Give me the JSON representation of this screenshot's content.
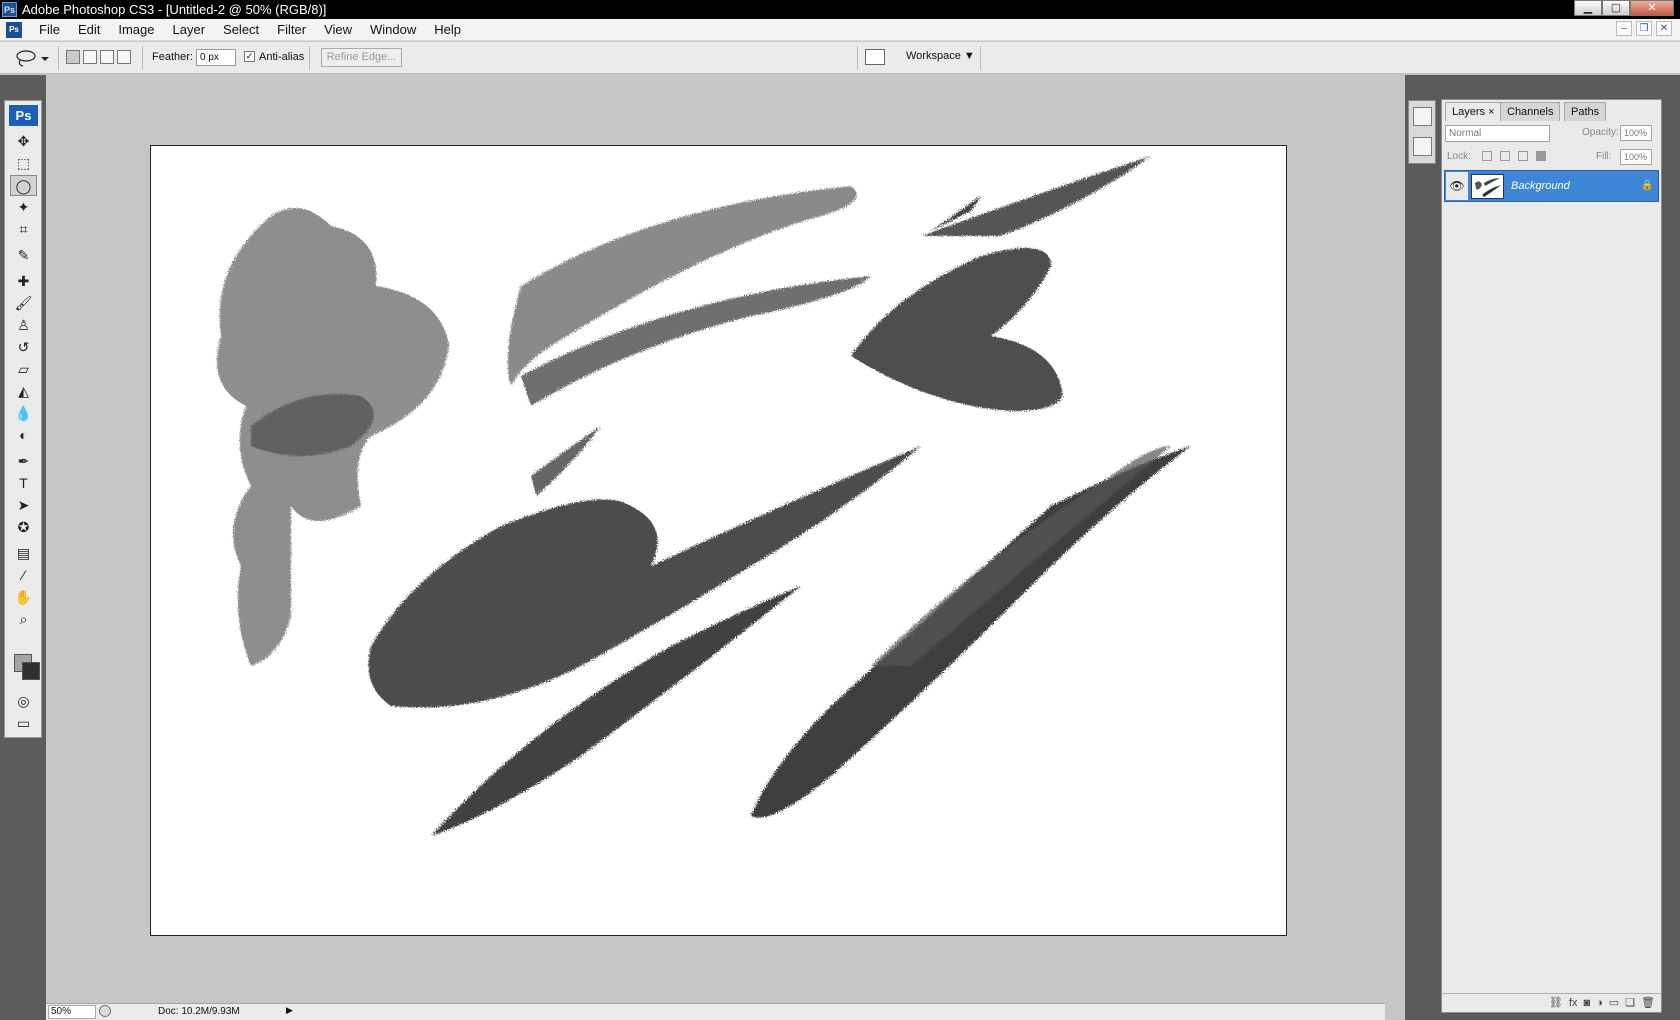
{
  "window": {
    "title": "Adobe Photoshop CS3 - [Untitled-2 @ 50% (RGB/8)]",
    "app_icon": "Ps",
    "controls": {
      "minimize": "▁",
      "maximize": "▢",
      "close": "✕"
    }
  },
  "menubar": {
    "items": [
      "File",
      "Edit",
      "Image",
      "Layer",
      "Select",
      "Filter",
      "View",
      "Window",
      "Help"
    ],
    "doc_controls": {
      "minimize": "–",
      "restore": "❐",
      "close": "✕"
    }
  },
  "options": {
    "tool_icon": "lasso-icon",
    "feather_label": "Feather:",
    "feather_value": "0 px",
    "antialias_label": "Anti-alias",
    "antialias_checked": "✓",
    "refine_edge_label": "Refine Edge...",
    "workspace_label": "Workspace ▼"
  },
  "toolbox": {
    "badge": "Ps",
    "tools": [
      {
        "name": "move-tool-icon",
        "glyph": "✥"
      },
      {
        "name": "marquee-tool-icon",
        "glyph": "⬚"
      },
      {
        "name": "lasso-tool-icon",
        "glyph": "◯"
      },
      {
        "name": "magic-wand-tool-icon",
        "glyph": "✦"
      },
      {
        "name": "crop-tool-icon",
        "glyph": "⌗"
      },
      {
        "name": "slice-tool-icon",
        "glyph": "✎"
      },
      {
        "name": "healing-brush-tool-icon",
        "glyph": "✚"
      },
      {
        "name": "brush-tool-icon",
        "glyph": "🖌"
      },
      {
        "name": "clone-stamp-tool-icon",
        "glyph": "♙"
      },
      {
        "name": "history-brush-tool-icon",
        "glyph": "↺"
      },
      {
        "name": "eraser-tool-icon",
        "glyph": "▱"
      },
      {
        "name": "paint-bucket-tool-icon",
        "glyph": "◭"
      },
      {
        "name": "blur-tool-icon",
        "glyph": "💧"
      },
      {
        "name": "dodge-tool-icon",
        "glyph": "◐"
      },
      {
        "name": "pen-tool-icon",
        "glyph": "✒"
      },
      {
        "name": "type-tool-icon",
        "glyph": "T"
      },
      {
        "name": "path-selection-tool-icon",
        "glyph": "➤"
      },
      {
        "name": "custom-shape-tool-icon",
        "glyph": "✪"
      },
      {
        "name": "notes-tool-icon",
        "glyph": "▤"
      },
      {
        "name": "eyedropper-tool-icon",
        "glyph": "⁄"
      },
      {
        "name": "hand-tool-icon",
        "glyph": "✋"
      },
      {
        "name": "zoom-tool-icon",
        "glyph": "⌕"
      }
    ],
    "active_tool_index": 2,
    "foreground_color": "#a6a6a6",
    "background_color": "#303030",
    "quick_mask_glyph": "◎",
    "screen_mode_glyph": "▭"
  },
  "status": {
    "zoom": "50%",
    "doc": "Doc: 10.2M/9.93M",
    "arrow": "▶"
  },
  "layers_panel": {
    "tabs": [
      "Layers",
      "Channels",
      "Paths"
    ],
    "active_tab": "Layers",
    "tab_close": "×",
    "blend_mode": "Normal",
    "opacity_label": "Opacity:",
    "opacity_value": "100%",
    "lock_label": "Lock:",
    "fill_label": "Fill:",
    "fill_value": "100%",
    "layers": [
      {
        "name": "Background",
        "visible": true,
        "locked": true
      }
    ],
    "footer_icons": [
      "link-icon",
      "fx-icon",
      "mask-icon",
      "adjustment-icon",
      "group-icon",
      "new-layer-icon",
      "trash-icon"
    ],
    "footer_glyphs": [
      "⛓",
      "fx",
      "◙",
      "◑",
      "▭",
      "❏",
      "🗑"
    ]
  },
  "colors": {
    "titlebar_bg": "#000000",
    "accent_selected_layer": "#3e86d6",
    "workspace_gray": "#c6c6c6",
    "panel_dark": "#5a5a5a"
  }
}
